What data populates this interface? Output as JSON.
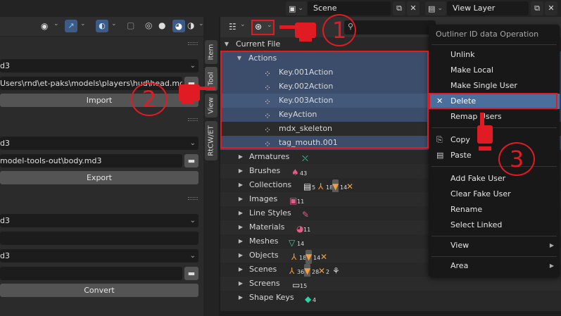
{
  "topbar": {
    "scene_label": "Scene",
    "view_layer_label": "View Layer"
  },
  "left_panel": {
    "field_1": "d3",
    "head_path": "Users\\rnd\\et-paks\\models\\players\\hud\\head.md3",
    "import_label": "Import",
    "field_2": "d3",
    "body_path": "model-tools-out\\body.md3",
    "export_label": "Export",
    "field_3": "d3",
    "field_4": "d3",
    "convert_label": "Convert"
  },
  "vtabs": [
    "Item",
    "Tool",
    "View",
    "RtCW/ET"
  ],
  "outliner": {
    "current_file": "Current File",
    "actions_label": "Actions",
    "actions": [
      "Key.001Action",
      "Key.002Action",
      "Key.003Action",
      "KeyAction",
      "mdx_skeleton",
      "tag_mouth.001"
    ],
    "categories": [
      {
        "label": "Armatures",
        "counts": []
      },
      {
        "label": "Brushes",
        "counts": [
          "43"
        ]
      },
      {
        "label": "Collections",
        "counts": [
          "5",
          "18",
          "14"
        ]
      },
      {
        "label": "Images",
        "counts": [
          "11"
        ]
      },
      {
        "label": "Line Styles",
        "counts": []
      },
      {
        "label": "Materials",
        "counts": [
          "11"
        ]
      },
      {
        "label": "Meshes",
        "counts": [
          "14"
        ]
      },
      {
        "label": "Objects",
        "counts": [
          "18",
          "14"
        ]
      },
      {
        "label": "Scenes",
        "counts": [
          "36",
          "28",
          "2"
        ]
      },
      {
        "label": "Screens",
        "counts": [
          "15"
        ]
      },
      {
        "label": "Shape Keys",
        "counts": [
          "4"
        ]
      }
    ]
  },
  "context_menu": {
    "title": "Outliner ID data Operation",
    "items": [
      "Unlink",
      "Make Local",
      "Make Single User",
      "Delete",
      "Remap Users",
      "Copy",
      "Paste",
      "Add Fake User",
      "Clear Fake User",
      "Rename",
      "Select Linked",
      "View",
      "Area"
    ],
    "active_item": "Delete"
  },
  "annotations": {
    "step_1": "1",
    "step_2": "2",
    "step_3": "3"
  },
  "icons": {
    "search": "search-icon",
    "folder": "folder-icon",
    "close": "close-icon",
    "action": "action-icon"
  },
  "colors": {
    "selection": "#3b4d6b",
    "active_menu": "#4a6f9c",
    "annotation": "#e01b24"
  }
}
